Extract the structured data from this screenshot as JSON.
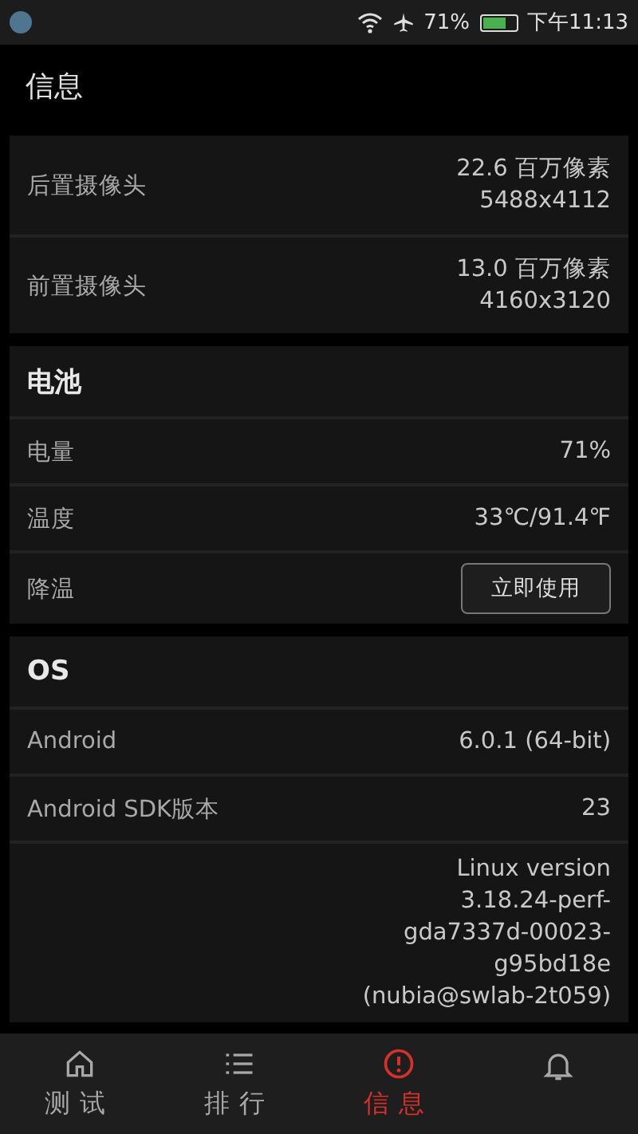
{
  "status_bar": {
    "battery_percent": "71%",
    "time": "下午11:13"
  },
  "app_bar": {
    "title": "信息"
  },
  "sections": [
    {
      "rows": [
        {
          "kind": "value",
          "label": "后置摄像头",
          "value_lines": [
            "22.6 百万像素",
            "5488x4112"
          ]
        },
        {
          "kind": "value",
          "label": "前置摄像头",
          "value_lines": [
            "13.0 百万像素",
            "4160x3120"
          ]
        }
      ]
    },
    {
      "header": "电池",
      "rows": [
        {
          "kind": "value",
          "label": "电量",
          "value_lines": [
            "71%"
          ]
        },
        {
          "kind": "value",
          "label": "温度",
          "value_lines": [
            "33℃/91.4℉"
          ]
        },
        {
          "kind": "button",
          "label": "降温",
          "button": "立即使用"
        }
      ]
    },
    {
      "header": "OS",
      "rows": [
        {
          "kind": "value",
          "label": "Android",
          "value_lines": [
            "6.0.1 (64-bit)"
          ]
        },
        {
          "kind": "value",
          "label": "Android SDK版本",
          "value_lines": [
            "23"
          ]
        },
        {
          "kind": "value",
          "value_lines": [
            "Linux version",
            "3.18.24-perf-",
            "gda7337d-00023-",
            "g95bd18e",
            "(nubia@swlab-2t059)"
          ]
        }
      ]
    }
  ],
  "bottom_nav": [
    {
      "kind": "home",
      "label": "测试",
      "selected": false
    },
    {
      "kind": "list",
      "label": "排行",
      "selected": false
    },
    {
      "kind": "alert",
      "label": "信息",
      "selected": true
    },
    {
      "kind": "bell",
      "selected": false
    }
  ]
}
